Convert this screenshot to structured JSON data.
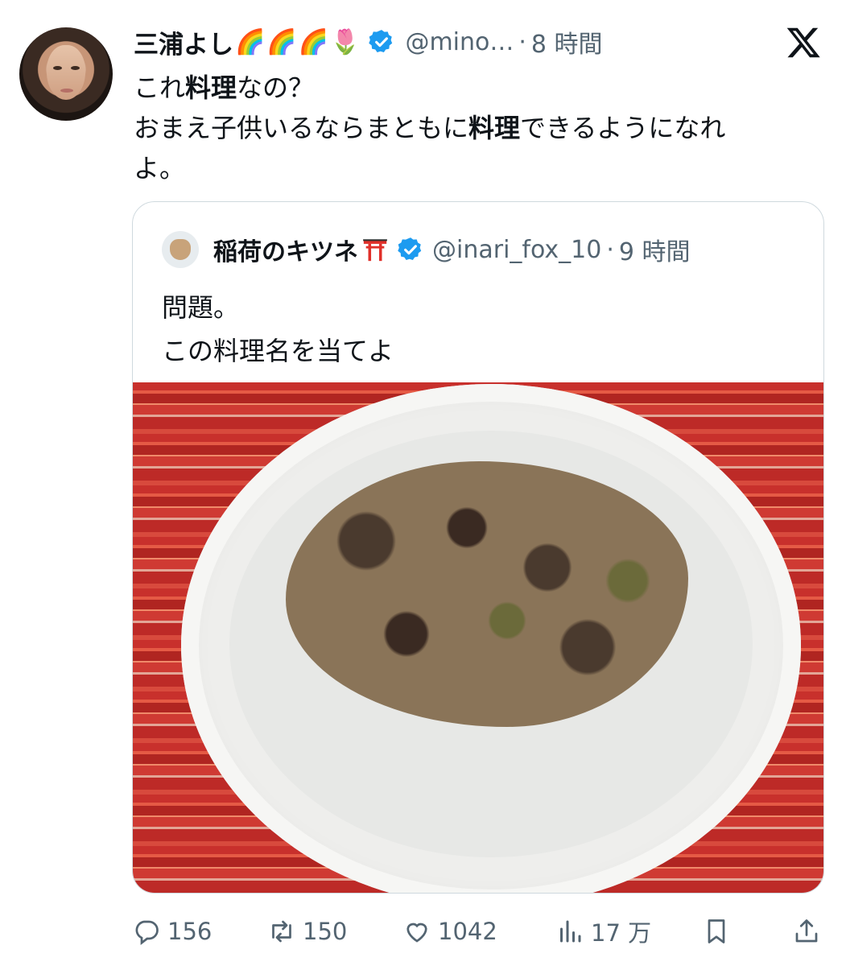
{
  "post": {
    "display_name": "三浦よし",
    "name_emojis": [
      "🌈",
      "🌈",
      "🌈",
      "🌷"
    ],
    "handle": "@mino…",
    "separator": "·",
    "time": "8 時間",
    "text_line1_a": "これ",
    "text_line1_b": "料理",
    "text_line1_c": "なの？",
    "text_line2_a": "おまえ子供いるならまともに",
    "text_line2_b": "料理",
    "text_line2_c": "できるようになれ",
    "text_line3": "よ。"
  },
  "quote": {
    "display_name": "稲荷のキツネ",
    "handle": "@inari_fox_10",
    "separator": "·",
    "time": "9 時間",
    "text_line1": "問題。",
    "text_line2": "この料理名を当てよ"
  },
  "actions": {
    "replies": "156",
    "reposts": "150",
    "likes": "1042",
    "views": "17 万"
  },
  "colors": {
    "verified": "#1d9bf0",
    "muted": "#536471",
    "text": "#0f1419"
  },
  "icons": [
    "x-logo-icon",
    "verified-badge-icon",
    "torii-icon",
    "reply-icon",
    "repost-icon",
    "like-icon",
    "views-icon",
    "bookmark-icon",
    "share-icon"
  ]
}
